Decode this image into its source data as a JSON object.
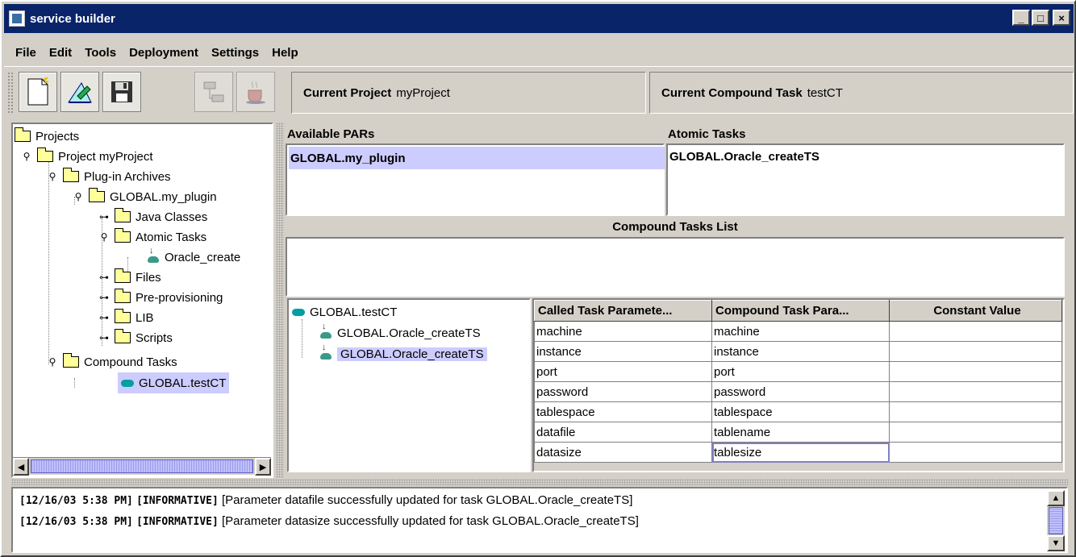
{
  "window": {
    "title": "service builder"
  },
  "menu": [
    "File",
    "Edit",
    "Tools",
    "Deployment",
    "Settings",
    "Help"
  ],
  "toolbar": {
    "current_project_label": "Current Project",
    "current_project_value": "myProject",
    "current_ct_label": "Current Compound Task",
    "current_ct_value": "testCT"
  },
  "tree": {
    "root": "Projects",
    "project": "Project myProject",
    "plugin_archives": "Plug-in Archives",
    "plugin": "GLOBAL.my_plugin",
    "java_classes": "Java Classes",
    "atomic_tasks": "Atomic Tasks",
    "atomic_item": "Oracle_create",
    "files": "Files",
    "pre_provisioning": "Pre-provisioning",
    "lib": "LIB",
    "scripts": "Scripts",
    "compound_tasks": "Compound Tasks",
    "compound_item": "GLOBAL.testCT"
  },
  "pars": {
    "header": "Available PARs",
    "items": [
      "GLOBAL.my_plugin"
    ]
  },
  "atomic": {
    "header": "Atomic Tasks",
    "items": [
      "GLOBAL.Oracle_createTS"
    ]
  },
  "compound_list": {
    "header": "Compound Tasks List"
  },
  "ct_tree": {
    "root": "GLOBAL.testCT",
    "children": [
      "GLOBAL.Oracle_createTS",
      "GLOBAL.Oracle_createTS"
    ]
  },
  "param_table": {
    "columns": [
      "Called Task Paramete...",
      "Compound Task Para...",
      "Constant Value"
    ],
    "rows": [
      [
        "machine",
        "machine",
        ""
      ],
      [
        "instance",
        "instance",
        ""
      ],
      [
        "port",
        "port",
        ""
      ],
      [
        "password",
        "password",
        ""
      ],
      [
        "tablespace",
        "tablespace",
        ""
      ],
      [
        "datafile",
        "tablename",
        ""
      ],
      [
        "datasize",
        "tablesize",
        ""
      ]
    ]
  },
  "log": [
    {
      "ts": "[12/16/03 5:38 PM]",
      "level": "[INFORMATIVE]",
      "msg": "[Parameter datafile successfully updated for task GLOBAL.Oracle_createTS]"
    },
    {
      "ts": "[12/16/03 5:38 PM]",
      "level": "[INFORMATIVE]",
      "msg": "[Parameter datasize successfully updated for task GLOBAL.Oracle_createTS]"
    }
  ],
  "colors": {
    "titlebar": "#0a246a",
    "selection": "#ccccff",
    "chrome": "#d4d0c8"
  }
}
